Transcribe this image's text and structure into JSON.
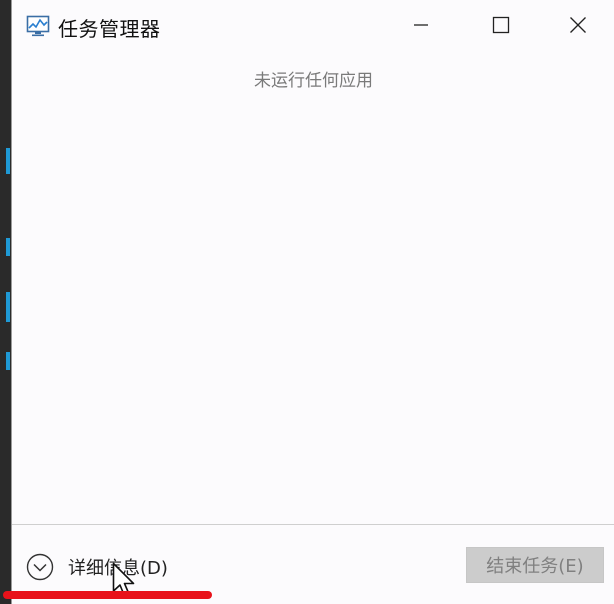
{
  "window": {
    "title": "任务管理器",
    "icon": "task-manager-icon"
  },
  "controls": {
    "minimize_icon": "minimize-icon",
    "maximize_icon": "maximize-icon",
    "close_icon": "close-icon"
  },
  "main": {
    "empty_message": "未运行任何应用"
  },
  "footer": {
    "details_label": "详细信息(D)",
    "details_icon": "chevron-down-circle-icon",
    "end_task_label": "结束任务(E)",
    "end_task_enabled": false
  },
  "annotation": {
    "underline_color": "#e8121a"
  },
  "colors": {
    "window_bg": "#fcfbfd",
    "disabled_button_bg": "#cccccc",
    "disabled_button_text": "#808080"
  }
}
